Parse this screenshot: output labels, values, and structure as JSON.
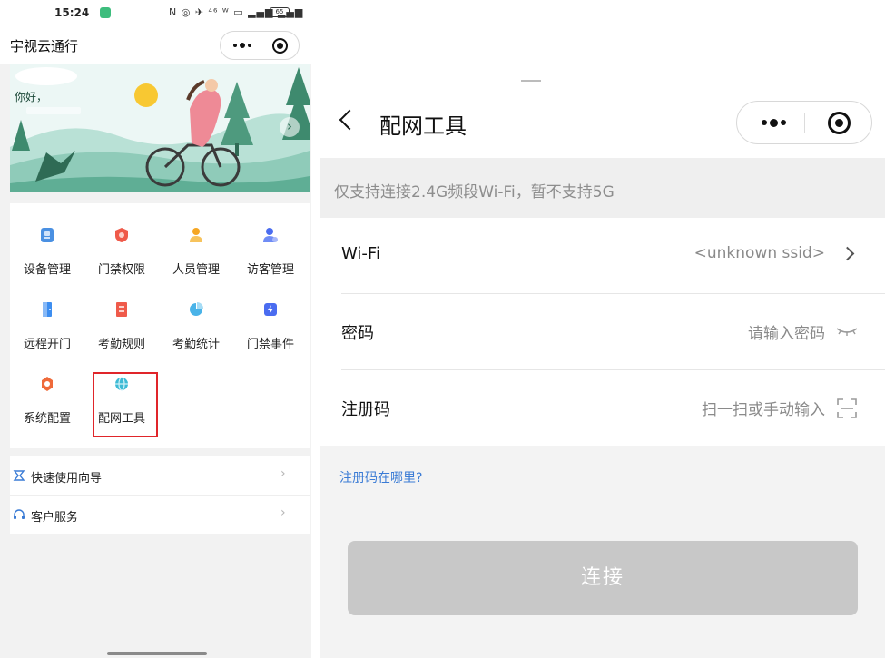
{
  "left": {
    "status_bar": {
      "time": "15:24",
      "icons": "N ◎ ✈ ⁴⁶ ᵂ ▭ ▂▄▆ ▂▄▆",
      "battery": "65"
    },
    "nav": {
      "title": "宇视云通行"
    },
    "banner": {
      "greeting": "你好，"
    },
    "grid": {
      "items": [
        {
          "label": "设备管理",
          "icon": "device-icon",
          "color": "#4a90e2"
        },
        {
          "label": "门禁权限",
          "icon": "shield-icon",
          "color": "#ef5a4a"
        },
        {
          "label": "人员管理",
          "icon": "person-icon",
          "color": "#f5a623"
        },
        {
          "label": "访客管理",
          "icon": "visitor-icon",
          "color": "#4a6cf0"
        },
        {
          "label": "远程开门",
          "icon": "door-icon",
          "color": "#3d8ef0"
        },
        {
          "label": "考勤规则",
          "icon": "rules-icon",
          "color": "#ef5a4a"
        },
        {
          "label": "考勤统计",
          "icon": "stats-icon",
          "color": "#4ab3e8"
        },
        {
          "label": "门禁事件",
          "icon": "event-icon",
          "color": "#4a6cf0"
        },
        {
          "label": "系统配置",
          "icon": "config-icon",
          "color": "#ef6a3a"
        },
        {
          "label": "配网工具",
          "icon": "globe-icon",
          "color": "#3dbbd5"
        }
      ]
    },
    "menu": [
      {
        "label": "快速使用向导",
        "icon": "guide-icon"
      },
      {
        "label": "客户服务",
        "icon": "headset-icon"
      }
    ]
  },
  "right": {
    "nav": {
      "title": "配网工具"
    },
    "notice": "仅支持连接2.4G频段Wi-Fi，暂不支持5G",
    "form": {
      "wifi": {
        "label": "Wi-Fi",
        "value": "<unknown ssid>"
      },
      "password": {
        "label": "密码",
        "placeholder": "请输入密码"
      },
      "reg_code": {
        "label": "注册码",
        "placeholder": "扫一扫或手动输入"
      }
    },
    "help_link": "注册码在哪里?",
    "connect_button": "连接"
  },
  "colors": {
    "highlight_box": "#e0252a",
    "link": "#3a7bd5",
    "button_disabled": "#c8c8c8"
  }
}
